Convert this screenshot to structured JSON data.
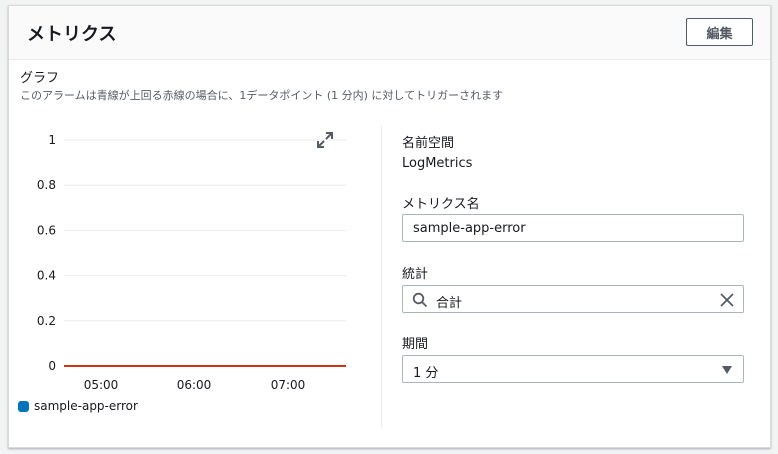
{
  "panel": {
    "title": "メトリクス",
    "edit_label": "編集"
  },
  "graph": {
    "label": "グラフ",
    "description": "このアラームは青線が上回る赤線の場合に、1データポイント (1 分内) に対してトリガーされます"
  },
  "chart_data": {
    "type": "line",
    "x": [
      "05:00",
      "06:00",
      "07:00"
    ],
    "y_ticks": [
      "1",
      "0.8",
      "0.6",
      "0.4",
      "0.2",
      "0"
    ],
    "ylim": [
      0,
      1
    ],
    "grid": true,
    "threshold": {
      "value": 0,
      "color": "#d13212"
    },
    "series": [
      {
        "name": "sample-app-error",
        "color": "#0073bb",
        "values": []
      }
    ],
    "legend_position": "bottom-left"
  },
  "fields": {
    "namespace_label": "名前空間",
    "namespace_value": "LogMetrics",
    "metric_name_label": "メトリクス名",
    "metric_name_value": "sample-app-error",
    "statistic_label": "統計",
    "statistic_value": "合計",
    "period_label": "期間",
    "period_value": "1 分"
  },
  "icons": {
    "expand": "expand-icon",
    "search": "search-icon",
    "clear": "close-icon",
    "caret": "caret-down-icon"
  }
}
